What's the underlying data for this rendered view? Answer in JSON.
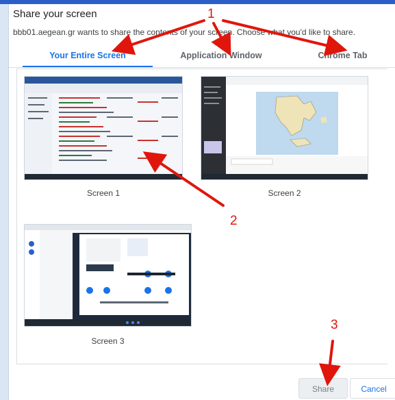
{
  "dialog": {
    "title": "Share your screen",
    "subtitle": "bbb01.aegean.gr wants to share the contents of your screen. Choose what you'd like to share."
  },
  "tabs": [
    {
      "label": "Your Entire Screen",
      "active": true
    },
    {
      "label": "Application Window",
      "active": false
    },
    {
      "label": "Chrome Tab",
      "active": false
    }
  ],
  "screens": [
    {
      "label": "Screen 1"
    },
    {
      "label": "Screen 2"
    },
    {
      "label": "Screen 3"
    }
  ],
  "buttons": {
    "share_label": "Share",
    "cancel_label": "Cancel"
  },
  "annotations": {
    "step1": "1",
    "step2": "2",
    "step3": "3"
  },
  "colors": {
    "accent": "#1a73e8",
    "annotation": "#e0160d"
  }
}
